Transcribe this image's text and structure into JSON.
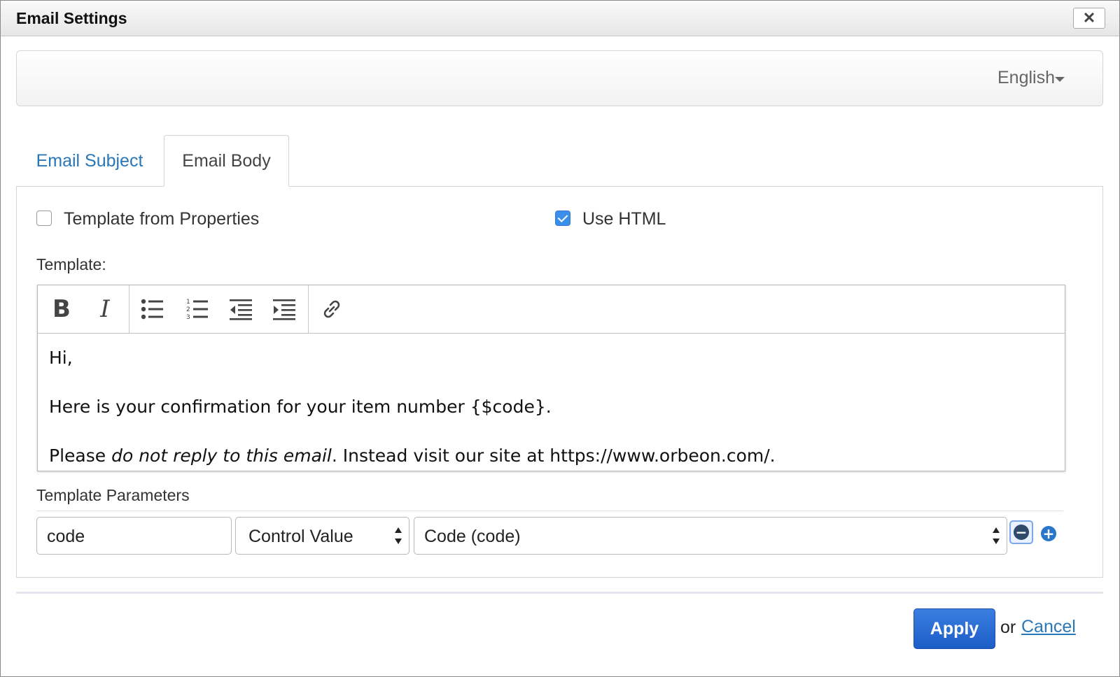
{
  "dialog": {
    "title": "Email Settings",
    "close_label": "✕"
  },
  "language": {
    "selected": "English"
  },
  "tabs": [
    {
      "label": "Email Subject",
      "active": false
    },
    {
      "label": "Email Body",
      "active": true
    }
  ],
  "options": {
    "template_from_properties": {
      "label": "Template from Properties",
      "checked": false
    },
    "use_html": {
      "label": "Use HTML",
      "checked": true
    }
  },
  "template": {
    "label": "Template:",
    "toolbar": {
      "bold_label": "B",
      "italic_label": "I",
      "icons": [
        "bold-icon",
        "italic-icon",
        "bulleted-list-icon",
        "numbered-list-icon",
        "outdent-icon",
        "indent-icon",
        "link-icon"
      ]
    },
    "content": {
      "line1": "Hi,",
      "line2": "Here is your confirmation for your item number {$code}.",
      "line3_prefix": "Please ",
      "line3_italic": "do not reply to this email",
      "line3_suffix": ". Instead visit our site at https://www.orbeon.com/."
    }
  },
  "parameters": {
    "label": "Template Parameters",
    "rows": [
      {
        "name": "code",
        "type": "Control Value",
        "control": "Code (code)"
      }
    ]
  },
  "footer": {
    "apply_label": "Apply",
    "or_text": "or",
    "cancel_label": "Cancel"
  },
  "colors": {
    "link": "#2a77b8",
    "checkbox_checked": "#3b8eea",
    "apply_button": "#1d5dc7"
  }
}
